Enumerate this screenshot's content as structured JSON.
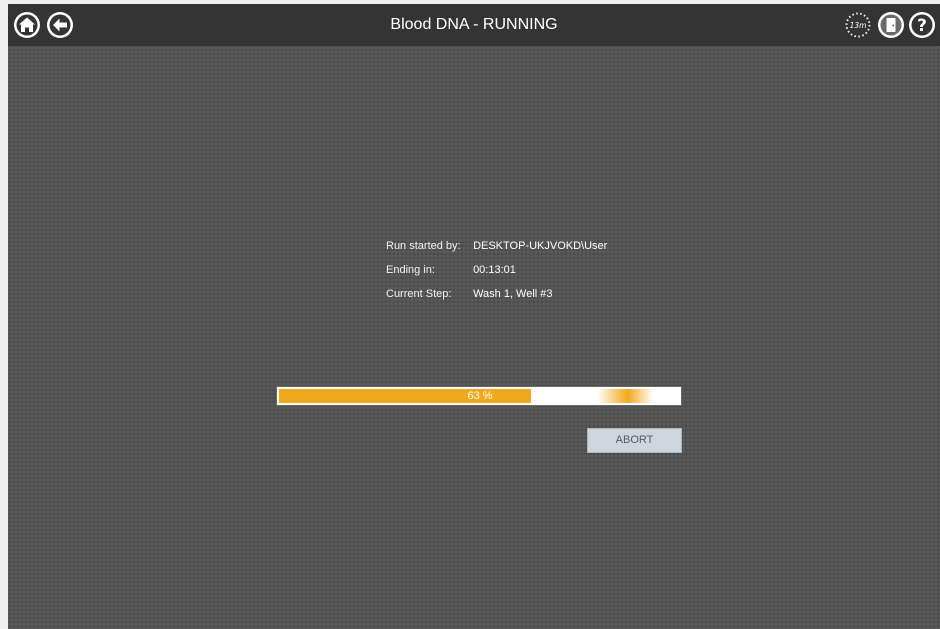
{
  "header": {
    "title": "Blood DNA - RUNNING",
    "timer_icon_text": "13m",
    "icons": {
      "home": "home-icon",
      "back": "back-arrow-icon",
      "timer": "timer-icon",
      "exit": "exit-door-icon",
      "help": "help-icon"
    }
  },
  "run_info": {
    "started_by_label": "Run started by:",
    "started_by_value": "DESKTOP-UKJVOKD\\User",
    "ending_in_label": "Ending in:",
    "ending_in_value": "00:13:01",
    "current_step_label": "Current Step:",
    "current_step_value": "Wash 1, Well #3"
  },
  "progress": {
    "percent": 63,
    "label": "63 %"
  },
  "actions": {
    "abort_label": "ABORT"
  },
  "colors": {
    "background": "#545454",
    "header": "#343434",
    "accent": "#f2a81d",
    "abort_button": "#ced5dd"
  }
}
